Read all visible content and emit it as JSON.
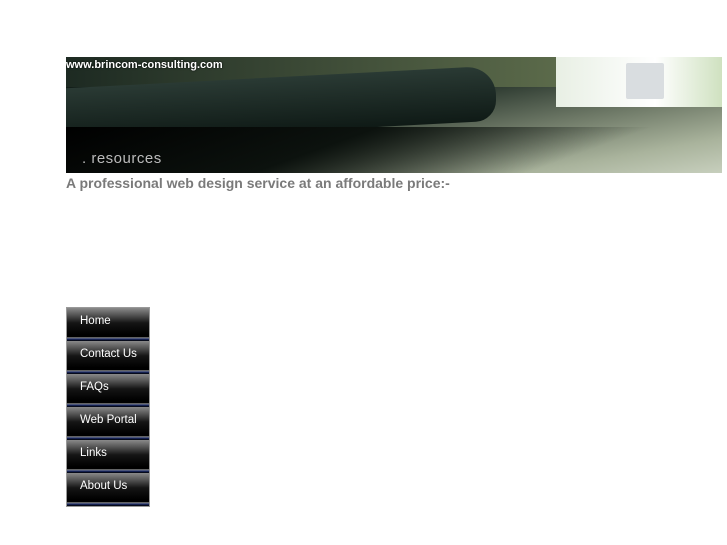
{
  "banner": {
    "site_url": "www.brincom-consulting.com",
    "caption": ". resources"
  },
  "tagline": "A professional web design service at an affordable price:-",
  "nav": [
    {
      "label": "Home"
    },
    {
      "label": "Contact Us"
    },
    {
      "label": "FAQs"
    },
    {
      "label": "Web Portal"
    },
    {
      "label": "Links"
    },
    {
      "label": "About Us"
    }
  ]
}
